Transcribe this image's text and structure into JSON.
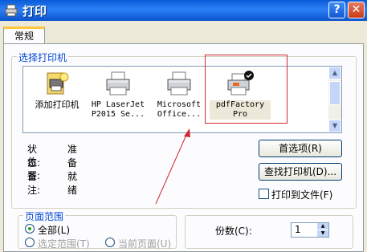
{
  "window": {
    "title": "打印",
    "help_label": "?",
    "close_label": "✕"
  },
  "tab": {
    "label": "常规"
  },
  "select_printer": {
    "group_label": "选择打印机",
    "printers": [
      {
        "label": "添加打印机",
        "icon": "add-printer-icon"
      },
      {
        "label": "HP LaserJet\nP2015 Se...",
        "icon": "printer-icon"
      },
      {
        "label": "Microsoft\nOffice...",
        "icon": "printer-icon"
      },
      {
        "label": "pdfFactory\nPro",
        "icon": "default-printer-icon",
        "selected": true
      }
    ],
    "status_label": "状态:",
    "status_value": "准备就绪",
    "location_label": "位置:",
    "comment_label": "备注:",
    "preferences_button": "首选项(R)",
    "find_printer_button": "查找打印机(D)...",
    "print_to_file_label": "打印到文件(F)"
  },
  "page_range": {
    "group_label": "页面范围",
    "all_label": "全部(L)",
    "selection_label": "选定范围(T)",
    "current_page_label": "当前页面(U)"
  },
  "copies": {
    "label": "份数(C):",
    "value": "1"
  },
  "colors": {
    "annotation": "#d0282e",
    "title_bar": "#0a5bd8"
  }
}
